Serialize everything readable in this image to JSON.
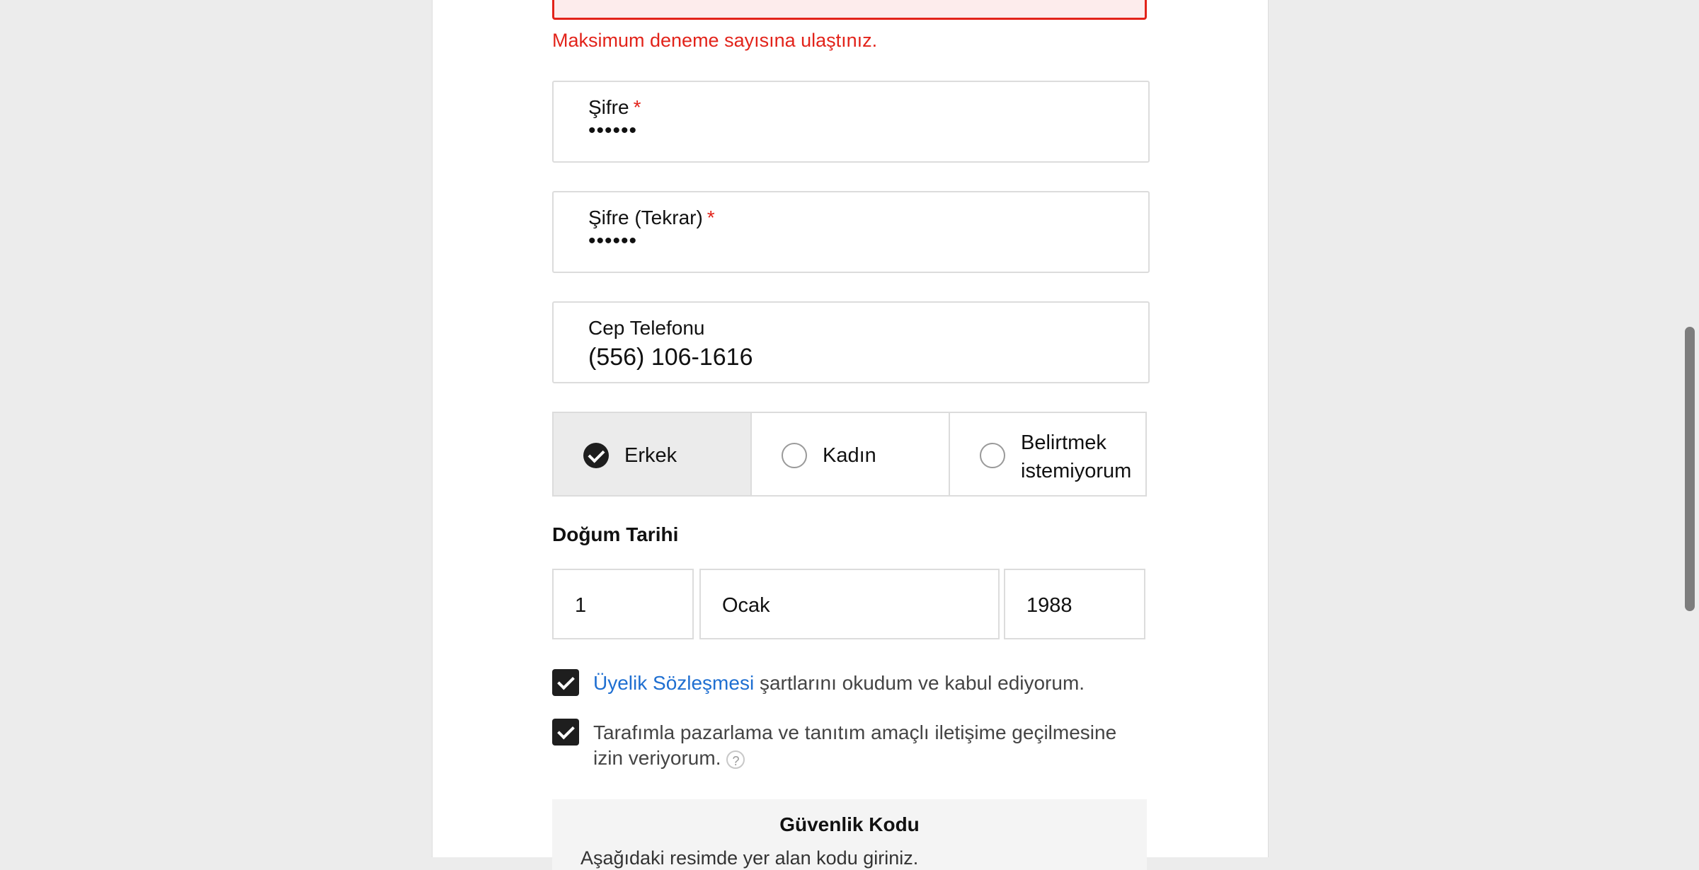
{
  "email": {
    "value": "...@...",
    "state": "error"
  },
  "errors": {
    "email": "Maksimum deneme sayısına ulaştınız."
  },
  "password": {
    "label": "Şifre",
    "required_mark": "*",
    "value": "••••••"
  },
  "password_repeat": {
    "label": "Şifre (Tekrar)",
    "required_mark": "*",
    "value": "••••••"
  },
  "phone": {
    "label": "Cep Telefonu",
    "value": "(556) 106-1616"
  },
  "gender": {
    "options": [
      "Erkek",
      "Kadın",
      "Belirtmek istemiyorum"
    ],
    "selected": "Erkek"
  },
  "birthdate": {
    "label": "Doğum Tarihi",
    "day": "1",
    "month": "Ocak",
    "year": "1988"
  },
  "agreements": {
    "terms_link": "Üyelik Sözleşmesi",
    "terms_text": " şartlarını okudum ve kabul ediyorum.",
    "terms_checked": true,
    "marketing_text": "Tarafımla pazarlama ve tanıtım amaçlı iletişime geçilmesine izin veriyorum.",
    "marketing_checked": true,
    "help_icon": "?"
  },
  "captcha": {
    "title": "Güvenlik Kodu",
    "description": "Aşağıdaki resimde yer alan kodu giriniz."
  },
  "colors": {
    "error": "#e2231a",
    "link": "#1f6fd1",
    "checkbox": "#1e1e1e",
    "selected_option_bg": "#ebebeb"
  }
}
